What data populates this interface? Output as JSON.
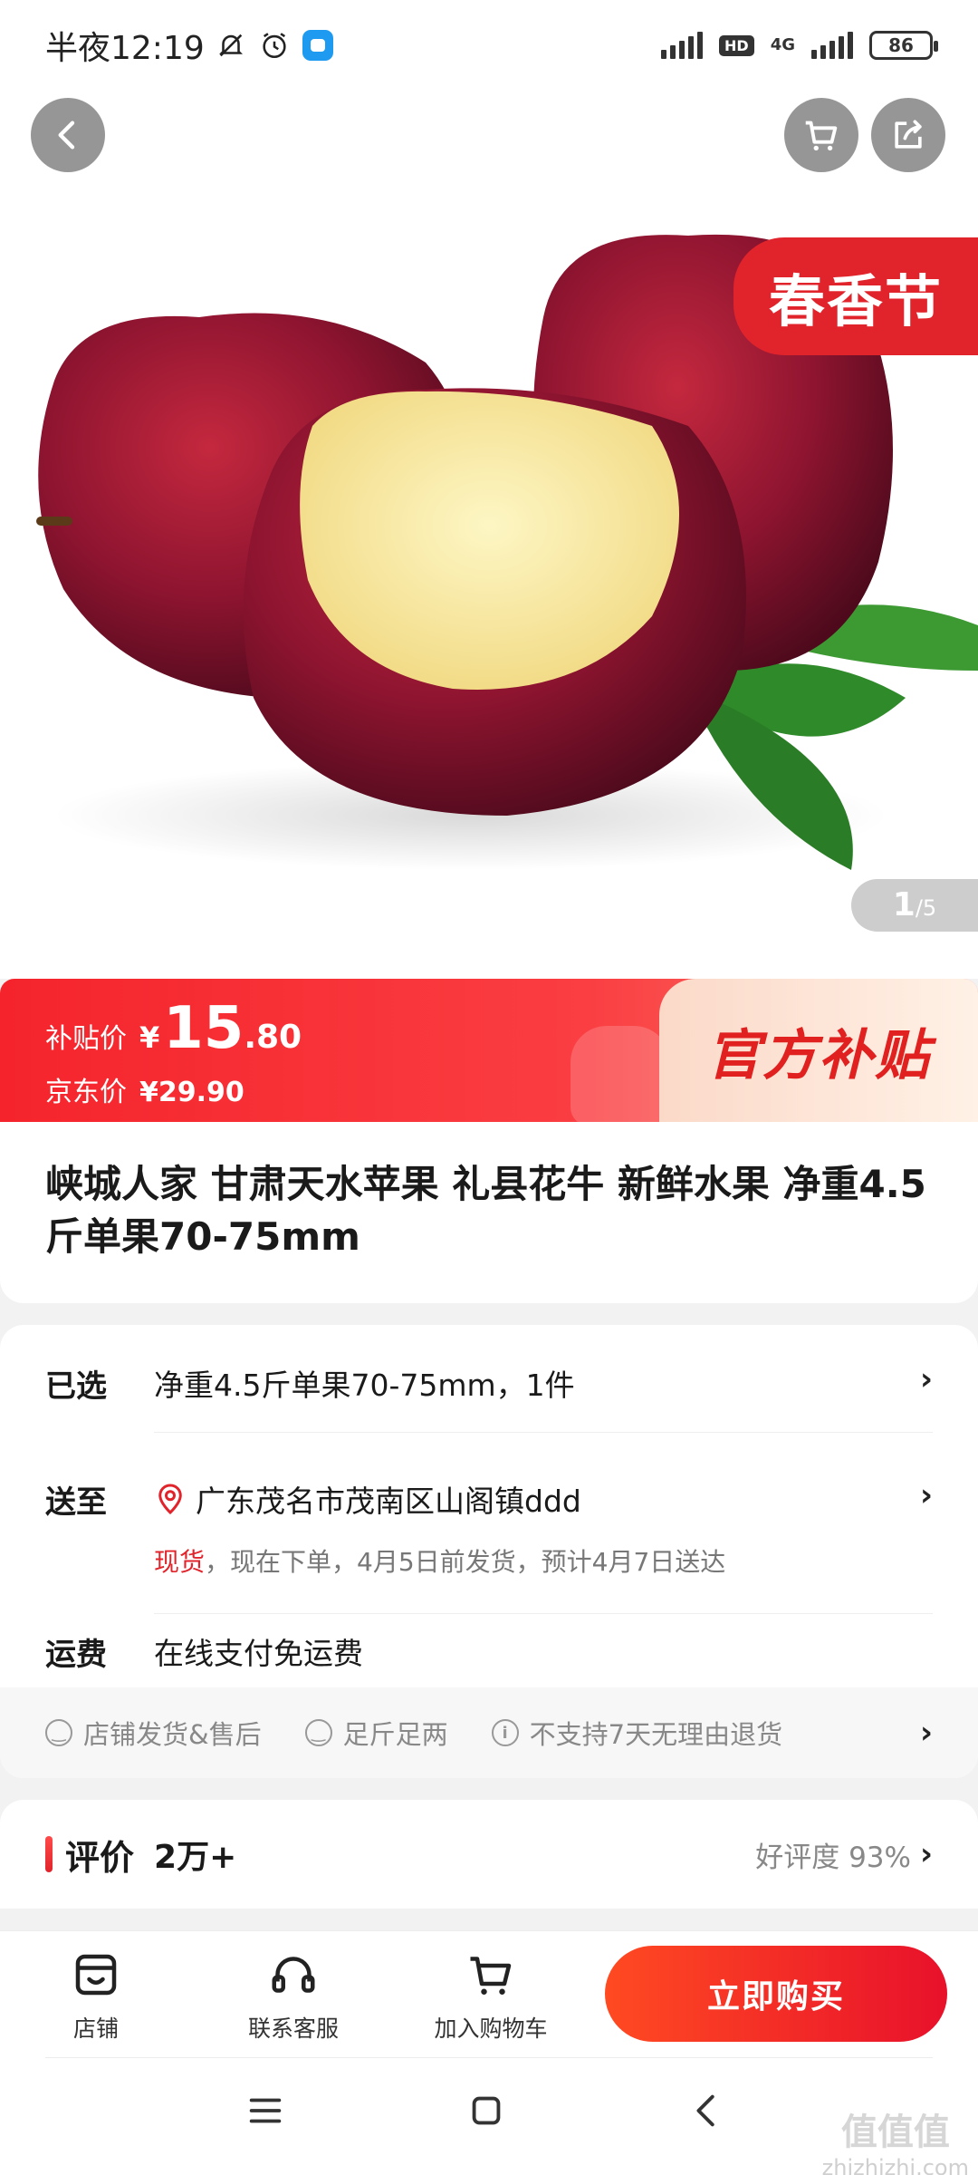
{
  "status_bar": {
    "time": "半夜12:19",
    "network": "4G",
    "hd": "HD",
    "battery": "86"
  },
  "hero": {
    "promo_tag": "春香节",
    "page_current": "1",
    "page_total": "/5"
  },
  "price_banner": {
    "subsidy_label": "补贴价",
    "currency": "¥",
    "subsidy_price_int": "15",
    "subsidy_price_dec": ".80",
    "jd_label": "京东价",
    "jd_price": "¥29.90",
    "official_subsidy": "官方补贴"
  },
  "product": {
    "title": "峡城人家 甘肃天水苹果 礼县花牛 新鲜水果 净重4.5斤单果70-75mm"
  },
  "spec": {
    "selected_label": "已选",
    "selected_value": "净重4.5斤单果70-75mm，1件",
    "ship_to_label": "送至",
    "address": "广东茂名市茂南区山阁镇ddd",
    "stock_status": "现货",
    "ship_note": "，现在下单，4月5日前发货，预计4月7日送达",
    "freight_label": "运费",
    "freight_value": "在线支付免运费",
    "chevron": "›"
  },
  "services": [
    "店铺发货&售后",
    "足斤足两",
    "不支持7天无理由退货"
  ],
  "review": {
    "title": "评价",
    "count": "2万+",
    "rate": "好评度 93%"
  },
  "bottom_bar": {
    "store": "店铺",
    "service": "联系客服",
    "add_cart": "加入购物车",
    "buy_now": "立即购买"
  },
  "watermark": {
    "cn": "值值值",
    "url": "zhizhizhi.com"
  },
  "colors": {
    "accent_red": "#e1242b",
    "banner_red": "#f5242c",
    "subsidy_bg": "#fbd9c8"
  }
}
